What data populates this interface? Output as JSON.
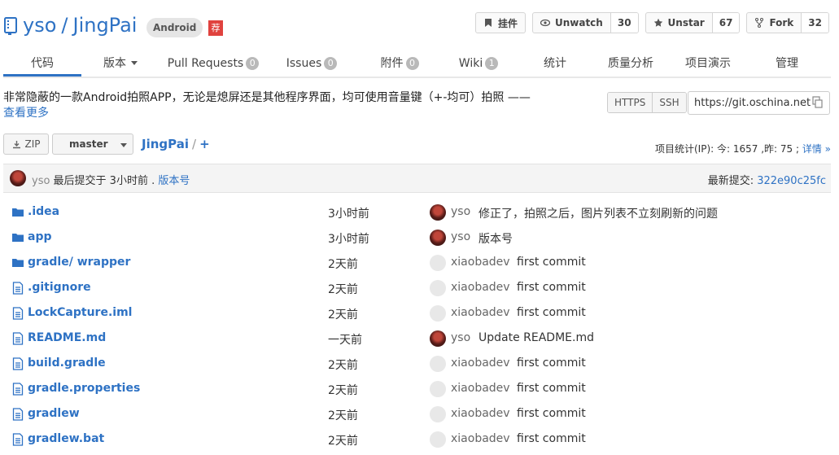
{
  "header": {
    "owner": "yso",
    "repo": "JingPai",
    "lang_badge": "Android",
    "rec_badge": "荐",
    "actions": [
      {
        "label": "挂件",
        "count": "",
        "icon": "bookmark-icon"
      },
      {
        "label": "Unwatch",
        "count": "30",
        "icon": "eye-icon"
      },
      {
        "label": "Unstar",
        "count": "67",
        "icon": "star-icon"
      },
      {
        "label": "Fork",
        "count": "32",
        "icon": "fork-icon"
      }
    ]
  },
  "nav": [
    {
      "label": "代码",
      "count": "",
      "active": true
    },
    {
      "label": "版本",
      "count": "",
      "dropdown": true
    },
    {
      "label": "Pull Requests",
      "count": "0"
    },
    {
      "label": "Issues",
      "count": "0"
    },
    {
      "label": "附件",
      "count": "0"
    },
    {
      "label": "Wiki",
      "count": "1"
    },
    {
      "label": "统计",
      "count": ""
    },
    {
      "label": "质量分析",
      "count": ""
    },
    {
      "label": "项目演示",
      "count": ""
    },
    {
      "label": "管理",
      "count": ""
    }
  ],
  "description": {
    "text": "非常隐蔽的一款Android拍照APP，无论是熄屏还是其他程序界面，均可使用音量键（+-均可）拍照 —— ",
    "more": "查看更多"
  },
  "clone": {
    "https": "HTTPS",
    "ssh": "SSH",
    "url": "https://git.oschina.net"
  },
  "toolbar": {
    "zip": "ZIP",
    "branch": "master",
    "path_root": "JingPai",
    "path_sep": "/",
    "add": "+",
    "stats_prefix": "项目统计(IP): 今: 1657 ,昨: 75 ; ",
    "stats_link": "详情 »"
  },
  "commit_bar": {
    "user": "yso",
    "text": " 最后提交于 3小时前 . ",
    "version_link": "版本号",
    "latest_label": "最新提交: ",
    "hash": "322e90c25fc"
  },
  "files": [
    {
      "name": ".idea",
      "type": "folder",
      "time": "3小时前",
      "user": "yso",
      "avatar": "dark",
      "msg": "修正了，拍照之后，图片列表不立刻刷新的问题"
    },
    {
      "name": "app",
      "type": "folder",
      "time": "3小时前",
      "user": "yso",
      "avatar": "dark",
      "msg": "版本号"
    },
    {
      "name": "gradle/ ",
      "name_link": "wrapper",
      "type": "folder",
      "time": "2天前",
      "user": "xiaobadev",
      "avatar": "light",
      "msg": "first commit"
    },
    {
      "name": ".gitignore",
      "type": "file",
      "time": "2天前",
      "user": "xiaobadev",
      "avatar": "light",
      "msg": "first commit"
    },
    {
      "name": "LockCapture.iml",
      "type": "file",
      "time": "2天前",
      "user": "xiaobadev",
      "avatar": "light",
      "msg": "first commit"
    },
    {
      "name": "README.md",
      "type": "file",
      "time": "一天前",
      "user": "yso",
      "avatar": "dark",
      "msg": "Update README.md"
    },
    {
      "name": "build.gradle",
      "type": "file",
      "time": "2天前",
      "user": "xiaobadev",
      "avatar": "light",
      "msg": "first commit"
    },
    {
      "name": "gradle.properties",
      "type": "file",
      "time": "2天前",
      "user": "xiaobadev",
      "avatar": "light",
      "msg": "first commit"
    },
    {
      "name": "gradlew",
      "type": "file",
      "time": "2天前",
      "user": "xiaobadev",
      "avatar": "light",
      "msg": "first commit"
    },
    {
      "name": "gradlew.bat",
      "type": "file",
      "time": "2天前",
      "user": "xiaobadev",
      "avatar": "light",
      "msg": "first commit"
    }
  ],
  "colors": {
    "link": "#2e72c4",
    "rec_badge": "#e0423e",
    "count_pill": "#b9b9b9"
  }
}
